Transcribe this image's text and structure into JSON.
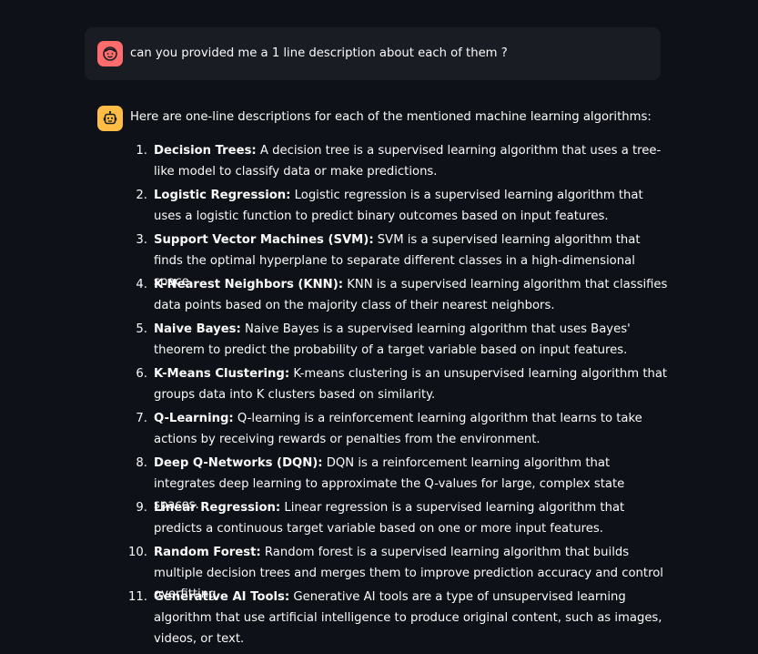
{
  "user_message": {
    "text": "can you provided me a 1 line description about each of them ?"
  },
  "assistant_message": {
    "intro": "Here are one-line descriptions for each of the mentioned machine learning algorithms:",
    "items": [
      {
        "number": "1.",
        "name": "Decision Trees:",
        "description": " A decision tree is a supervised learning algorithm that uses a tree-like model to classify data or make predictions."
      },
      {
        "number": "2.",
        "name": "Logistic Regression:",
        "description": " Logistic regression is a supervised learning algorithm that uses a logistic function to predict binary outcomes based on input features."
      },
      {
        "number": "3.",
        "name": "Support Vector Machines (SVM):",
        "description": " SVM is a supervised learning algorithm that finds the optimal hyperplane to separate different classes in a high-dimensional space."
      },
      {
        "number": "4.",
        "name": "K-Nearest Neighbors (KNN):",
        "description": " KNN is a supervised learning algorithm that classifies data points based on the majority class of their nearest neighbors."
      },
      {
        "number": "5.",
        "name": "Naive Bayes:",
        "description": " Naive Bayes is a supervised learning algorithm that uses Bayes' theorem to predict the probability of a target variable based on input features."
      },
      {
        "number": "6.",
        "name": "K-Means Clustering:",
        "description": " K-means clustering is an unsupervised learning algorithm that groups data into K clusters based on similarity."
      },
      {
        "number": "7.",
        "name": "Q-Learning:",
        "description": " Q-learning is a reinforcement learning algorithm that learns to take actions by receiving rewards or penalties from the environment."
      },
      {
        "number": "8.",
        "name": "Deep Q-Networks (DQN):",
        "description": " DQN is a reinforcement learning algorithm that integrates deep learning to approximate the Q-values for large, complex state spaces."
      },
      {
        "number": "9.",
        "name": "Linear Regression:",
        "description": " Linear regression is a supervised learning algorithm that predicts a continuous target variable based on one or more input features."
      },
      {
        "number": "10.",
        "name": "Random Forest:",
        "description": " Random forest is a supervised learning algorithm that builds multiple decision trees and merges them to improve prediction accuracy and control overfitting."
      },
      {
        "number": "11.",
        "name": "Generative AI Tools:",
        "description": " Generative AI tools are a type of unsupervised learning algorithm that use artificial intelligence to produce original content, such as images, videos, or text."
      }
    ]
  },
  "icons": {
    "user_avatar": "user-face-icon",
    "assistant_avatar": "robot-icon"
  },
  "colors": {
    "background": "#0e1117",
    "user_bubble": "#1a1c24",
    "user_avatar": "#ff6c6c",
    "assistant_avatar": "#ffbd45",
    "text": "#fafafa"
  }
}
